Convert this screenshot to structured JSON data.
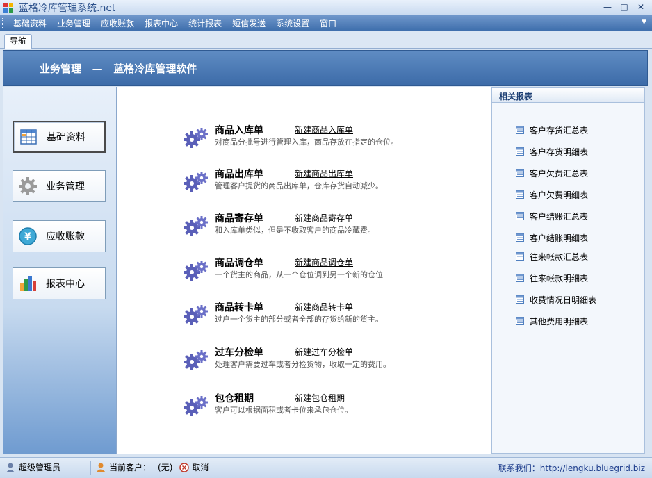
{
  "window": {
    "title": "蓝格冷库管理系统.net",
    "controls": {
      "minimize": "—",
      "maximize": "□",
      "close": "✕"
    }
  },
  "menu": {
    "items": [
      "基础资料",
      "业务管理",
      "应收账款",
      "报表中心",
      "统计报表",
      "短信发送",
      "系统设置",
      "窗口"
    ]
  },
  "tabs": [
    {
      "label": "导航"
    }
  ],
  "banner": {
    "title": "业务管理   —   蓝格冷库管理软件"
  },
  "nav": {
    "buttons": [
      {
        "label": "基础资料",
        "icon": "grid-table-icon",
        "active": true
      },
      {
        "label": "业务管理",
        "icon": "gear-icon",
        "active": false
      },
      {
        "label": "应收账款",
        "icon": "yen-coin-icon",
        "active": false
      },
      {
        "label": "报表中心",
        "icon": "bar-chart-icon",
        "active": false
      }
    ]
  },
  "entries": [
    {
      "title": "商品入库单",
      "link": "新建商品入库单",
      "desc": "对商品分批号进行管理入库，商品存放在指定的仓位。"
    },
    {
      "title": "商品出库单",
      "link": "新建商品出库单",
      "desc": "管理客户提货的商品出库单，仓库存货自动减少。"
    },
    {
      "title": "商品寄存单",
      "link": "新建商品寄存单",
      "desc": "和入库单类似，但是不收取客户的商品冷藏费。"
    },
    {
      "title": "商品调仓单",
      "link": "新建商品调仓单",
      "desc": "一个货主的商品，从一个仓位调到另一个新的仓位"
    },
    {
      "title": "商品转卡单",
      "link": "新建商品转卡单",
      "desc": "过户一个货主的部分或者全部的存货给新的货主。"
    },
    {
      "title": "过车分检单",
      "link": "新建过车分检单",
      "desc": "处理客户需要过车或者分检货物，收取一定的费用。"
    },
    {
      "title": "包仓租期",
      "link": "新建包仓租期",
      "desc": "客户可以根据面积或者卡位来承包仓位。"
    }
  ],
  "reports": {
    "title": "相关报表",
    "items": [
      "客户存货汇总表",
      "客户存货明细表",
      "客户欠费汇总表",
      "客户欠费明细表",
      "客户结账汇总表",
      "客户结账明细表",
      "往来帐款汇总表",
      "往来帐款明细表",
      "收费情况日明细表",
      "其他费用明细表"
    ]
  },
  "status": {
    "user": "超级管理员",
    "customer_label": "当前客户：",
    "customer_value": "(无)",
    "cancel": "取消",
    "contact": "联系我们：http://lengku.bluegrid.biz"
  },
  "colors": {
    "menubar": "#3f6fad",
    "banner": "#4a79b5",
    "accent_icon": "#5a5fb8"
  }
}
